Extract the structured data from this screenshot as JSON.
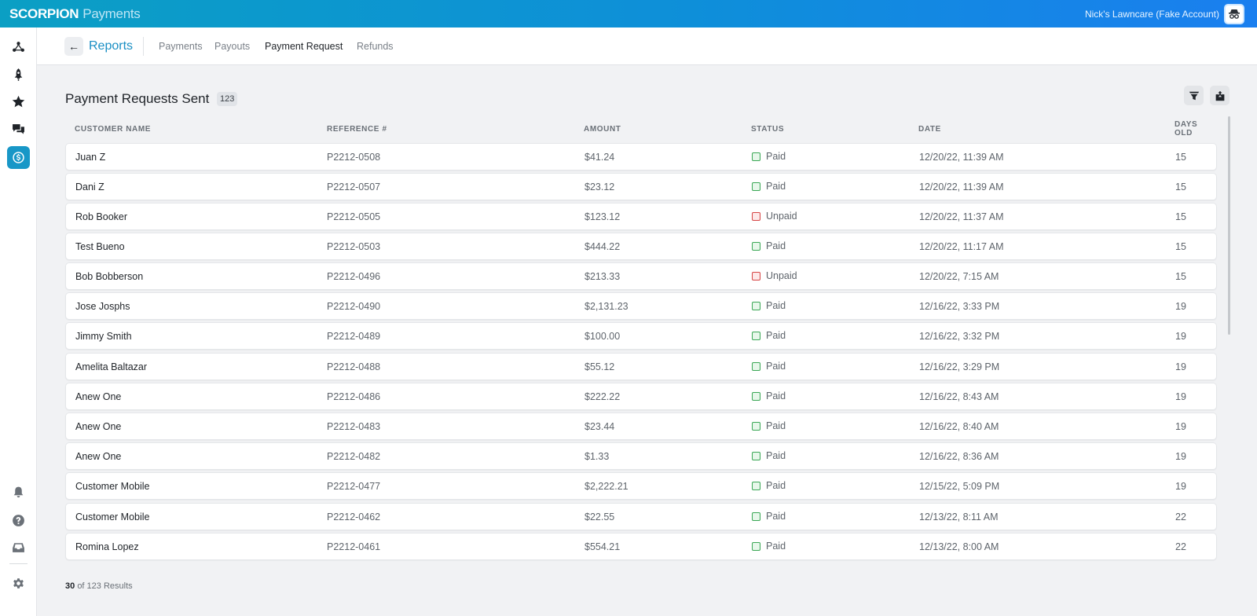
{
  "app": {
    "brand_main": "SCORPION",
    "brand_sub": "Payments",
    "account_name": "Nick's Lawncare (Fake Account)"
  },
  "sidebar": {
    "items": [
      {
        "name": "dashboard",
        "icon": "network-icon"
      },
      {
        "name": "launch",
        "icon": "rocket-icon"
      },
      {
        "name": "reviews",
        "icon": "star-icon"
      },
      {
        "name": "messages",
        "icon": "chat-icon"
      },
      {
        "name": "payments",
        "icon": "dollar-circle-icon",
        "active": true
      },
      {
        "name": "notifications",
        "icon": "bell-icon"
      },
      {
        "name": "help",
        "icon": "help-icon"
      },
      {
        "name": "inbox",
        "icon": "inbox-icon"
      },
      {
        "name": "settings",
        "icon": "gear-icon"
      }
    ]
  },
  "header": {
    "back_icon": "arrow-left-icon",
    "title": "Reports",
    "tabs": [
      {
        "label": "Payments",
        "active": false
      },
      {
        "label": "Payouts",
        "active": false
      },
      {
        "label": "Payment Request",
        "active": true
      },
      {
        "label": "Refunds",
        "active": false
      }
    ]
  },
  "main": {
    "title": "Payment Requests Sent",
    "count": "123",
    "filter_icon": "filter-icon",
    "export_icon": "export-icon",
    "columns": {
      "name": "CUSTOMER NAME",
      "ref": "REFERENCE #",
      "amount": "AMOUNT",
      "status": "STATUS",
      "date": "DATE",
      "days_line1": "DAYS",
      "days_line2": "OLD"
    },
    "rows": [
      {
        "name": "Juan Z",
        "ref": "P2212-0508",
        "amount": "$41.24",
        "status": "Paid",
        "date": "12/20/22, 11:39 AM",
        "days": "15"
      },
      {
        "name": "Dani Z",
        "ref": "P2212-0507",
        "amount": "$23.12",
        "status": "Paid",
        "date": "12/20/22, 11:39 AM",
        "days": "15"
      },
      {
        "name": "Rob Booker",
        "ref": "P2212-0505",
        "amount": "$123.12",
        "status": "Unpaid",
        "date": "12/20/22, 11:37 AM",
        "days": "15"
      },
      {
        "name": "Test Bueno",
        "ref": "P2212-0503",
        "amount": "$444.22",
        "status": "Paid",
        "date": "12/20/22, 11:17 AM",
        "days": "15"
      },
      {
        "name": "Bob Bobberson",
        "ref": "P2212-0496",
        "amount": "$213.33",
        "status": "Unpaid",
        "date": "12/20/22, 7:15 AM",
        "days": "15"
      },
      {
        "name": "Jose Josphs",
        "ref": "P2212-0490",
        "amount": "$2,131.23",
        "status": "Paid",
        "date": "12/16/22, 3:33 PM",
        "days": "19"
      },
      {
        "name": "Jimmy Smith",
        "ref": "P2212-0489",
        "amount": "$100.00",
        "status": "Paid",
        "date": "12/16/22, 3:32 PM",
        "days": "19"
      },
      {
        "name": "Amelita Baltazar",
        "ref": "P2212-0488",
        "amount": "$55.12",
        "status": "Paid",
        "date": "12/16/22, 3:29 PM",
        "days": "19"
      },
      {
        "name": "Anew One",
        "ref": "P2212-0486",
        "amount": "$222.22",
        "status": "Paid",
        "date": "12/16/22, 8:43 AM",
        "days": "19"
      },
      {
        "name": "Anew One",
        "ref": "P2212-0483",
        "amount": "$23.44",
        "status": "Paid",
        "date": "12/16/22, 8:40 AM",
        "days": "19"
      },
      {
        "name": "Anew One",
        "ref": "P2212-0482",
        "amount": "$1.33",
        "status": "Paid",
        "date": "12/16/22, 8:36 AM",
        "days": "19"
      },
      {
        "name": "Customer Mobile",
        "ref": "P2212-0477",
        "amount": "$2,222.21",
        "status": "Paid",
        "date": "12/15/22, 5:09 PM",
        "days": "19"
      },
      {
        "name": "Customer Mobile",
        "ref": "P2212-0462",
        "amount": "$22.55",
        "status": "Paid",
        "date": "12/13/22, 8:11 AM",
        "days": "22"
      },
      {
        "name": "Romina Lopez",
        "ref": "P2212-0461",
        "amount": "$554.21",
        "status": "Paid",
        "date": "12/13/22, 8:00 AM",
        "days": "22"
      }
    ],
    "results_shown": "30",
    "results_text": "of 123 Results"
  },
  "colors": {
    "accent": "#1897c7",
    "paid": "#3aa755",
    "unpaid": "#d64545"
  }
}
